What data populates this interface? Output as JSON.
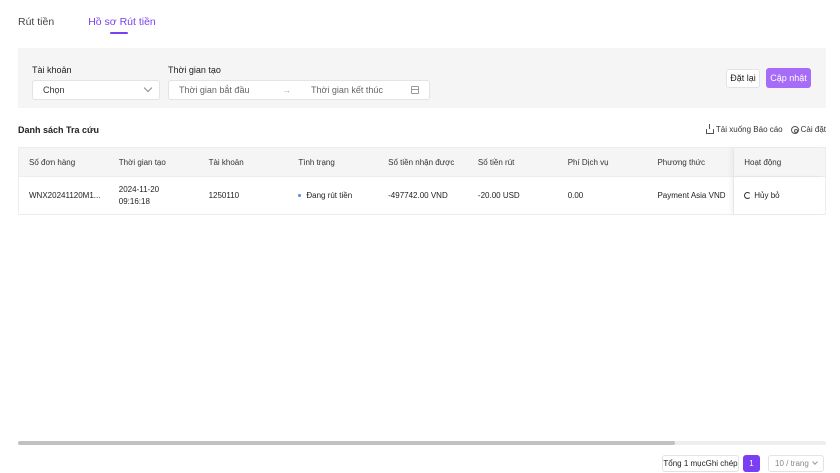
{
  "tabs": [
    {
      "label": "Rút tiền",
      "active": false
    },
    {
      "label": "Hồ sơ Rút tiền",
      "active": true
    }
  ],
  "filter": {
    "account_label": "Tài khoản",
    "account_value": "Chọn",
    "time_label": "Thời gian tạo",
    "start_placeholder": "Thời gian bắt đầu",
    "range_arrow": "→",
    "end_placeholder": "Thời gian kết thúc",
    "reset_label": "Đặt lại",
    "update_label": "Cập nhật"
  },
  "list": {
    "title": "Danh sách Tra cứu",
    "download_label": "Tải xuống Báo cáo",
    "settings_label": "Cài đặt"
  },
  "table": {
    "columns": [
      "Số đơn hàng",
      "Thời gian tạo",
      "Tài khoản",
      "Tình trạng",
      "Số tiền nhận được",
      "Số tiền rút",
      "Phí Dịch vụ",
      "Phương thức",
      "Hoạt động"
    ],
    "rows": [
      {
        "order_no": "WNX20241120M1...",
        "created": "2024-11-20\n09:16:18",
        "account": "1250110",
        "status": "Đang rút tiền",
        "received": "-497742.00 VND",
        "withdrawn": "-20.00 USD",
        "fee": "0.00",
        "method": "Payment Asia VND",
        "action": "Hủy bỏ"
      }
    ]
  },
  "pagination": {
    "total": "Tổng 1 mụcGhi chép",
    "current_page": "1",
    "page_size": "10 / trang"
  },
  "colors": {
    "accent": "#7b3ff2",
    "button": "#a66cf7",
    "status_dot": "#4a8fe7"
  }
}
